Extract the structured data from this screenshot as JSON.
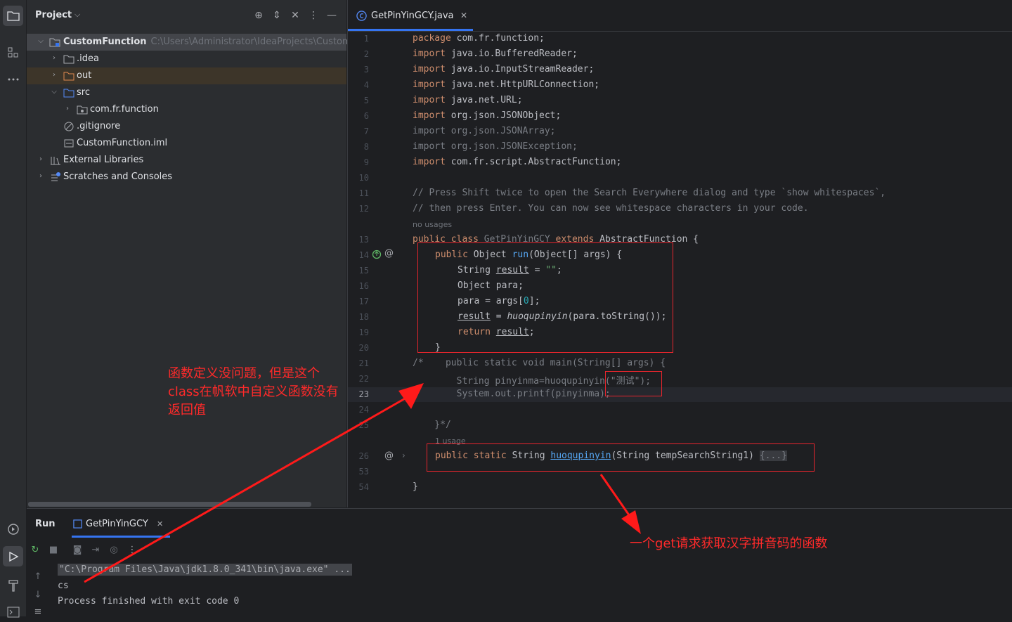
{
  "project": {
    "title": "Project",
    "tree": [
      {
        "label": "CustomFunction",
        "path": "C:\\Users\\Administrator\\IdeaProjects\\CustomFu"
      },
      {
        "label": ".idea"
      },
      {
        "label": "out"
      },
      {
        "label": "src"
      },
      {
        "label": "com.fr.function"
      },
      {
        "label": ".gitignore"
      },
      {
        "label": "CustomFunction.iml"
      },
      {
        "label": "External Libraries"
      },
      {
        "label": "Scratches and Consoles"
      }
    ]
  },
  "editor": {
    "tab_label": "GetPinYinGCY.java",
    "line_numbers": [
      "1",
      "2",
      "3",
      "4",
      "5",
      "6",
      "7",
      "8",
      "9",
      "10",
      "11",
      "12",
      "13",
      "14",
      "15",
      "16",
      "17",
      "18",
      "19",
      "20",
      "21",
      "22",
      "23",
      "24",
      "25",
      "26",
      "53",
      "54"
    ],
    "hint_no_usages": "no usages",
    "hint_usage": "1 usage",
    "lines": {
      "l1a": "package",
      "l1b": " com.fr.function;",
      "l2a": "import",
      "l2b": " java.io.BufferedReader;",
      "l3a": "import",
      "l3b": " java.io.InputStreamReader;",
      "l4a": "import",
      "l4b": " java.net.HttpURLConnection;",
      "l5a": "import",
      "l5b": " java.net.URL;",
      "l6a": "import",
      "l6b": " org.json.JSONObject;",
      "l7": "import org.json.JSONArray;",
      "l8": "import org.json.JSONException;",
      "l9a": "import",
      "l9b": " com.fr.script.AbstractFunction;",
      "l11": "// Press Shift twice to open the Search Everywhere dialog and type `show whitespaces`,",
      "l12": "// then press Enter. You can now see whitespace characters in your code.",
      "l13a": "public class",
      "l13b": " GetPinYinGCY",
      "l13c": " extends",
      "l13d": " AbstractFunction {",
      "l14a": "public",
      "l14b": " Object ",
      "l14c": "run",
      "l14d": "(Object[] args) {",
      "l15a": "String ",
      "l15b": "result",
      "l15c": " = ",
      "l15d": "\"\"",
      "l15e": ";",
      "l16": "Object para;",
      "l17a": "para = args[",
      "l17b": "0",
      "l17c": "];",
      "l18a": "result",
      "l18b": " = ",
      "l18c": "huoqupinyin",
      "l18d": "(para.toString());",
      "l19a": "return",
      "l19b": " ",
      "l19c": "result",
      "l19d": ";",
      "l20": "}",
      "l21": "/*    public static void main(String[] args) {",
      "l22": "        String pinyinma=huoqupinyin(\"测试\");",
      "l23": "        System.out.printf(pinyinma);",
      "l25": "    }*/",
      "l26a": "public static",
      "l26b": " String ",
      "l26c": "huoqupinyin",
      "l26d": "(String tempSearchString1) ",
      "l26e": "{...}",
      "l54": "}"
    }
  },
  "run": {
    "title": "Run",
    "tab_label": "GetPinYinGCY",
    "console": {
      "cmd": "\"C:\\Program Files\\Java\\jdk1.8.0_341\\bin\\java.exe\" ...",
      "output": "cs",
      "exit": "Process finished with exit code 0"
    }
  },
  "annotations": {
    "left": [
      "函数定义没问题，但是这个",
      "class在帆软中自定义函数没有",
      "返回值"
    ],
    "right": "一个get请求获取汉字拼音码的函数"
  },
  "colors": {
    "annotation": "#ff2a2a",
    "accent": "#3574f0"
  }
}
